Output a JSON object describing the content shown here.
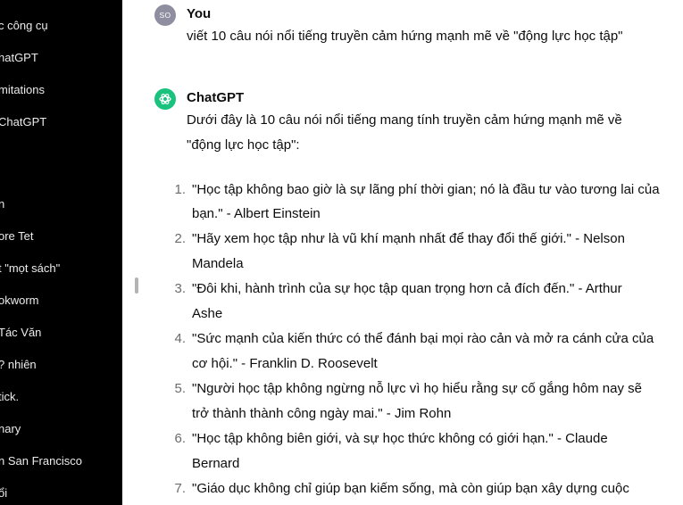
{
  "sidebar": {
    "items": [
      {
        "label": "c công cụ"
      },
      {
        "label": "hatGPT"
      },
      {
        "label": "mitations"
      },
      {
        "label": " ChatGPT"
      },
      {
        "label": "n"
      },
      {
        "label": "ore Tet"
      },
      {
        "label": "t \"mọt sách\""
      },
      {
        "label": "okworm"
      },
      {
        "label": "Tác Văn"
      },
      {
        "label": "? nhiên"
      },
      {
        "label": "tick."
      },
      {
        "label": "nary"
      },
      {
        "label": "n San Francisco"
      },
      {
        "label": "ổi"
      }
    ]
  },
  "user_message": {
    "avatar_initials": "SO",
    "author": "You",
    "text": "viết 10 câu nói nổi tiếng truyền cảm hứng mạnh mẽ về \"động lực học tập\""
  },
  "assistant_message": {
    "author": "ChatGPT",
    "intro_line1": "Dưới đây là 10 câu nói nổi tiếng mang tính truyền cảm hứng mạnh mẽ về",
    "intro_line2": "\"động lực học tập\":",
    "quotes": [
      {
        "num": "1.",
        "line1": "\"Học tập không bao giờ là sự lãng phí thời gian; nó là đầu tư vào tương lai của",
        "line2": "bạn.\" - Albert Einstein"
      },
      {
        "num": "2.",
        "line1": "\"Hãy xem học tập như là vũ khí mạnh nhất để thay đổi thế giới.\" - Nelson",
        "line2": "Mandela"
      },
      {
        "num": "3.",
        "line1": "\"Đôi khi, hành trình của sự học tập quan trọng hơn cả đích đến.\" - Arthur",
        "line2": "Ashe"
      },
      {
        "num": "4.",
        "line1": "\"Sức mạnh của kiến thức có thể đánh bại mọi rào cản và mở ra cánh cửa của",
        "line2": "cơ hội.\" - Franklin D. Roosevelt"
      },
      {
        "num": "5.",
        "line1": "\"Người học tập không ngừng nỗ lực vì họ hiểu rằng sự cố gắng hôm nay sẽ",
        "line2": "trở thành thành công ngày mai.\" - Jim Rohn"
      },
      {
        "num": "6.",
        "line1": "\"Học tập không biên giới, và sự học thức không có giới hạn.\" - Claude",
        "line2": "Bernard"
      },
      {
        "num": "7.",
        "line1": "\"Giáo dục không chỉ giúp bạn kiếm sống, mà còn giúp bạn xây dựng cuộc",
        "line2": ""
      }
    ]
  },
  "colors": {
    "sidebar_bg": "#000000",
    "assistant_avatar": "#19c37d",
    "user_avatar": "#8e8ea0"
  }
}
